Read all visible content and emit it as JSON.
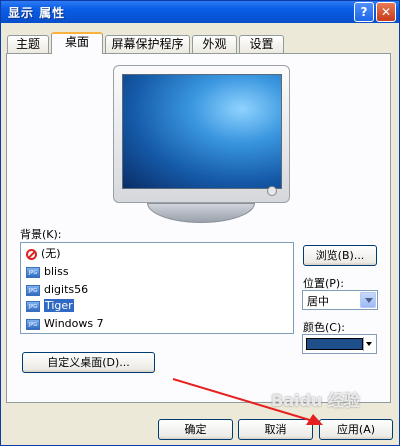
{
  "window": {
    "title": "显示 属性",
    "help_glyph": "?",
    "close_glyph": "✕"
  },
  "tabs": [
    {
      "label": "主题",
      "active": false
    },
    {
      "label": "桌面",
      "active": true
    },
    {
      "label": "屏幕保护程序",
      "active": false
    },
    {
      "label": "外观",
      "active": false
    },
    {
      "label": "设置",
      "active": false
    }
  ],
  "background": {
    "label": "背景(K):",
    "items": [
      {
        "label": "(无)",
        "icon": "none-icon",
        "selected": false
      },
      {
        "label": "bliss",
        "icon": "jpg-file-icon",
        "selected": false
      },
      {
        "label": "digits56",
        "icon": "jpg-file-icon",
        "selected": false
      },
      {
        "label": "Tiger",
        "icon": "jpg-file-icon",
        "selected": true
      },
      {
        "label": "Windows 7",
        "icon": "jpg-file-icon",
        "selected": false
      }
    ],
    "browse_label": "浏览(B)..."
  },
  "position": {
    "label": "位置(P):",
    "value": "居中"
  },
  "color": {
    "label": "颜色(C):",
    "value": "#1f4f8a"
  },
  "customize_label": "自定义桌面(D)...",
  "footer": {
    "ok": "确定",
    "cancel": "取消",
    "apply": "应用(A)"
  },
  "watermark": "Baidu 经验",
  "colors": {
    "titlebar": "#0a5ee8",
    "accent_arrow": "#e62020",
    "selection": "#316ac5"
  }
}
